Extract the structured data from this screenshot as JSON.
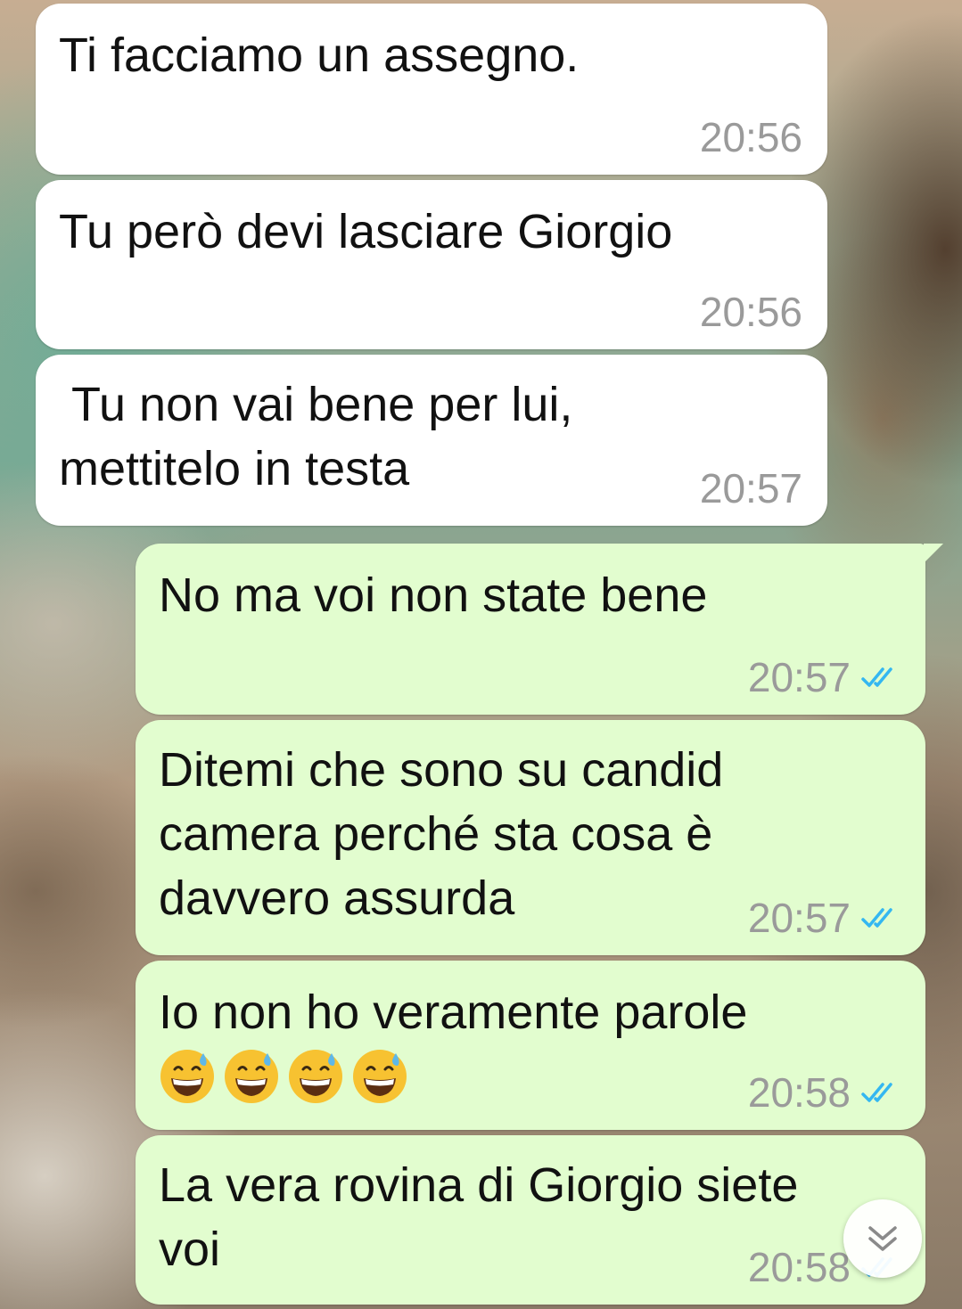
{
  "messages": [
    {
      "direction": "incoming",
      "text": "Ti facciamo un assegno.",
      "time": "20:56"
    },
    {
      "direction": "incoming",
      "text": "Tu però devi lasciare Giorgio",
      "time": "20:56"
    },
    {
      "direction": "incoming",
      "text": " Tu non vai bene per lui,\nmettitelo in testa",
      "time": "20:57"
    },
    {
      "direction": "outgoing",
      "text": "No ma voi non state bene",
      "time": "20:57",
      "status": "read"
    },
    {
      "direction": "outgoing",
      "text": "Ditemi che sono su candid\ncamera perché sta cosa è\ndavvero assurda",
      "time": "20:57",
      "status": "read"
    },
    {
      "direction": "outgoing",
      "text": "Io non ho veramente parole",
      "emoji": [
        "grinning-face-with-sweat",
        "grinning-face-with-sweat",
        "grinning-face-with-sweat",
        "grinning-face-with-sweat"
      ],
      "time": "20:58",
      "status": "read"
    },
    {
      "direction": "outgoing",
      "text": "La vera rovina di Giorgio siete\nvoi",
      "time": "20:58",
      "status": "read"
    }
  ],
  "colors": {
    "incoming_bubble": "#ffffff",
    "outgoing_bubble": "#e2fdcf",
    "read_ticks": "#34b7f1",
    "timestamp": "#9a9a9a"
  },
  "icons": {
    "read_receipt": "double-check-icon",
    "scroll_down": "double-chevron-down-icon"
  }
}
